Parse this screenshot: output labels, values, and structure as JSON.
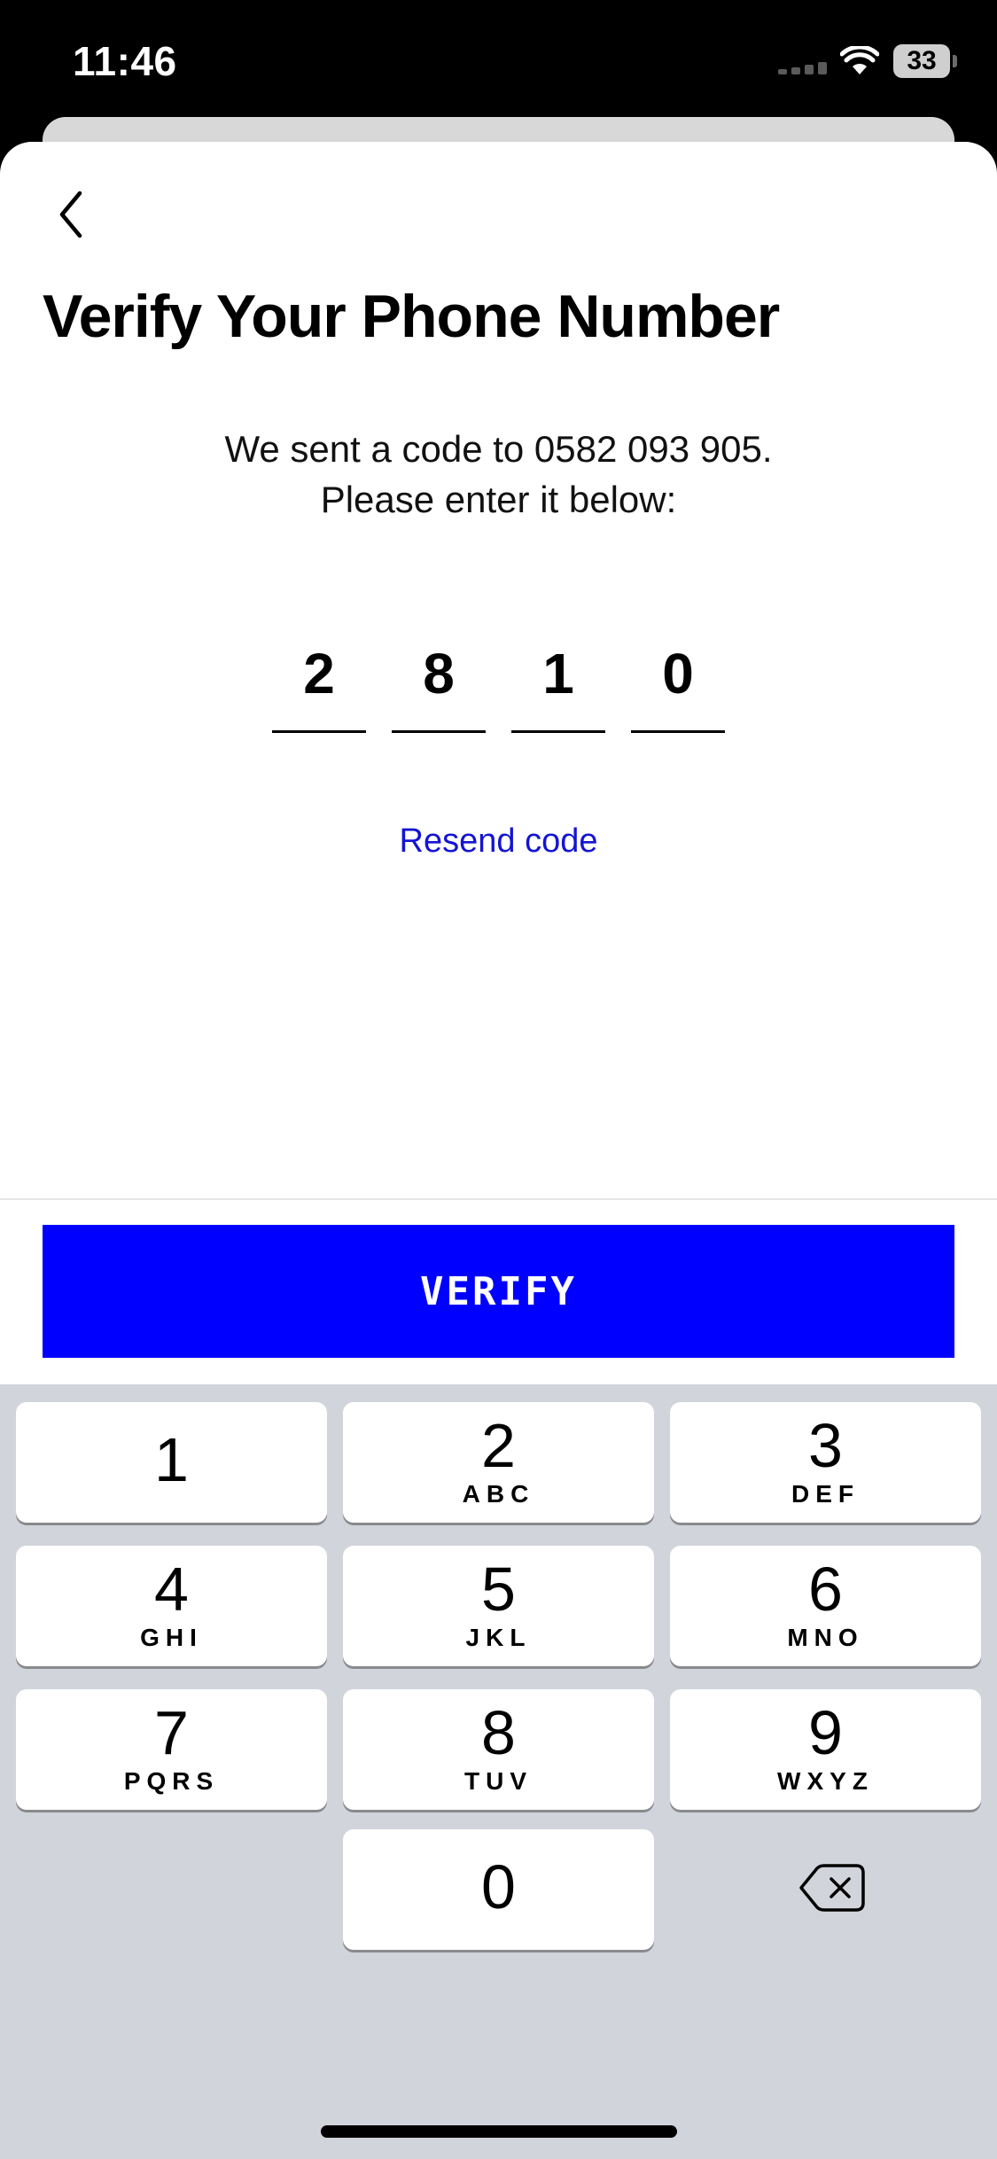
{
  "status_bar": {
    "time": "11:46",
    "battery": "33",
    "signal_icon": "cellular-signal-icon",
    "wifi_icon": "wifi-icon",
    "battery_icon": "battery-icon"
  },
  "header": {
    "back_icon": "chevron-left-icon",
    "title": "Verify Your Phone Number"
  },
  "main": {
    "instruction_line1": "We sent a code to 0582 093 905.",
    "instruction_line2": "Please enter it below:",
    "code_digits": [
      "2",
      "8",
      "1",
      "0"
    ],
    "resend_label": "Resend code"
  },
  "footer": {
    "verify_label": "VERIFY"
  },
  "keyboard": {
    "keys": [
      {
        "digit": "1",
        "letters": ""
      },
      {
        "digit": "2",
        "letters": "ABC"
      },
      {
        "digit": "3",
        "letters": "DEF"
      },
      {
        "digit": "4",
        "letters": "GHI"
      },
      {
        "digit": "5",
        "letters": "JKL"
      },
      {
        "digit": "6",
        "letters": "MNO"
      },
      {
        "digit": "7",
        "letters": "PQRS"
      },
      {
        "digit": "8",
        "letters": "TUV"
      },
      {
        "digit": "9",
        "letters": "WXYZ"
      },
      {
        "digit": "0",
        "letters": ""
      }
    ],
    "delete_icon": "backspace-icon"
  },
  "colors": {
    "accent": "#0000ff",
    "link": "#1414d4",
    "keyboard_bg": "#d1d4db"
  }
}
